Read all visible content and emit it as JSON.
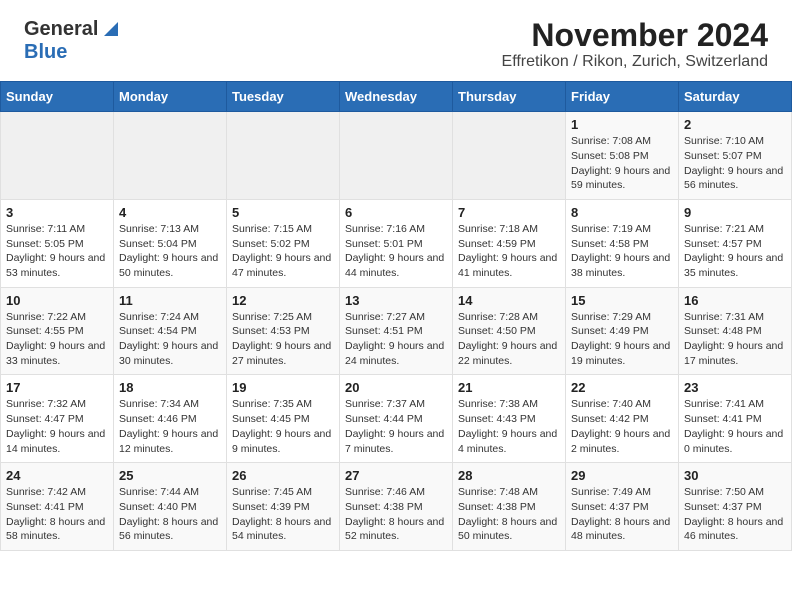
{
  "header": {
    "logo": {
      "line1": "General",
      "line2": "Blue"
    },
    "title": "November 2024",
    "subtitle": "Effretikon / Rikon, Zurich, Switzerland"
  },
  "calendar": {
    "days_of_week": [
      "Sunday",
      "Monday",
      "Tuesday",
      "Wednesday",
      "Thursday",
      "Friday",
      "Saturday"
    ],
    "weeks": [
      [
        {
          "num": "",
          "info": ""
        },
        {
          "num": "",
          "info": ""
        },
        {
          "num": "",
          "info": ""
        },
        {
          "num": "",
          "info": ""
        },
        {
          "num": "",
          "info": ""
        },
        {
          "num": "1",
          "info": "Sunrise: 7:08 AM\nSunset: 5:08 PM\nDaylight: 9 hours and 59 minutes."
        },
        {
          "num": "2",
          "info": "Sunrise: 7:10 AM\nSunset: 5:07 PM\nDaylight: 9 hours and 56 minutes."
        }
      ],
      [
        {
          "num": "3",
          "info": "Sunrise: 7:11 AM\nSunset: 5:05 PM\nDaylight: 9 hours and 53 minutes."
        },
        {
          "num": "4",
          "info": "Sunrise: 7:13 AM\nSunset: 5:04 PM\nDaylight: 9 hours and 50 minutes."
        },
        {
          "num": "5",
          "info": "Sunrise: 7:15 AM\nSunset: 5:02 PM\nDaylight: 9 hours and 47 minutes."
        },
        {
          "num": "6",
          "info": "Sunrise: 7:16 AM\nSunset: 5:01 PM\nDaylight: 9 hours and 44 minutes."
        },
        {
          "num": "7",
          "info": "Sunrise: 7:18 AM\nSunset: 4:59 PM\nDaylight: 9 hours and 41 minutes."
        },
        {
          "num": "8",
          "info": "Sunrise: 7:19 AM\nSunset: 4:58 PM\nDaylight: 9 hours and 38 minutes."
        },
        {
          "num": "9",
          "info": "Sunrise: 7:21 AM\nSunset: 4:57 PM\nDaylight: 9 hours and 35 minutes."
        }
      ],
      [
        {
          "num": "10",
          "info": "Sunrise: 7:22 AM\nSunset: 4:55 PM\nDaylight: 9 hours and 33 minutes."
        },
        {
          "num": "11",
          "info": "Sunrise: 7:24 AM\nSunset: 4:54 PM\nDaylight: 9 hours and 30 minutes."
        },
        {
          "num": "12",
          "info": "Sunrise: 7:25 AM\nSunset: 4:53 PM\nDaylight: 9 hours and 27 minutes."
        },
        {
          "num": "13",
          "info": "Sunrise: 7:27 AM\nSunset: 4:51 PM\nDaylight: 9 hours and 24 minutes."
        },
        {
          "num": "14",
          "info": "Sunrise: 7:28 AM\nSunset: 4:50 PM\nDaylight: 9 hours and 22 minutes."
        },
        {
          "num": "15",
          "info": "Sunrise: 7:29 AM\nSunset: 4:49 PM\nDaylight: 9 hours and 19 minutes."
        },
        {
          "num": "16",
          "info": "Sunrise: 7:31 AM\nSunset: 4:48 PM\nDaylight: 9 hours and 17 minutes."
        }
      ],
      [
        {
          "num": "17",
          "info": "Sunrise: 7:32 AM\nSunset: 4:47 PM\nDaylight: 9 hours and 14 minutes."
        },
        {
          "num": "18",
          "info": "Sunrise: 7:34 AM\nSunset: 4:46 PM\nDaylight: 9 hours and 12 minutes."
        },
        {
          "num": "19",
          "info": "Sunrise: 7:35 AM\nSunset: 4:45 PM\nDaylight: 9 hours and 9 minutes."
        },
        {
          "num": "20",
          "info": "Sunrise: 7:37 AM\nSunset: 4:44 PM\nDaylight: 9 hours and 7 minutes."
        },
        {
          "num": "21",
          "info": "Sunrise: 7:38 AM\nSunset: 4:43 PM\nDaylight: 9 hours and 4 minutes."
        },
        {
          "num": "22",
          "info": "Sunrise: 7:40 AM\nSunset: 4:42 PM\nDaylight: 9 hours and 2 minutes."
        },
        {
          "num": "23",
          "info": "Sunrise: 7:41 AM\nSunset: 4:41 PM\nDaylight: 9 hours and 0 minutes."
        }
      ],
      [
        {
          "num": "24",
          "info": "Sunrise: 7:42 AM\nSunset: 4:41 PM\nDaylight: 8 hours and 58 minutes."
        },
        {
          "num": "25",
          "info": "Sunrise: 7:44 AM\nSunset: 4:40 PM\nDaylight: 8 hours and 56 minutes."
        },
        {
          "num": "26",
          "info": "Sunrise: 7:45 AM\nSunset: 4:39 PM\nDaylight: 8 hours and 54 minutes."
        },
        {
          "num": "27",
          "info": "Sunrise: 7:46 AM\nSunset: 4:38 PM\nDaylight: 8 hours and 52 minutes."
        },
        {
          "num": "28",
          "info": "Sunrise: 7:48 AM\nSunset: 4:38 PM\nDaylight: 8 hours and 50 minutes."
        },
        {
          "num": "29",
          "info": "Sunrise: 7:49 AM\nSunset: 4:37 PM\nDaylight: 8 hours and 48 minutes."
        },
        {
          "num": "30",
          "info": "Sunrise: 7:50 AM\nSunset: 4:37 PM\nDaylight: 8 hours and 46 minutes."
        }
      ]
    ]
  }
}
